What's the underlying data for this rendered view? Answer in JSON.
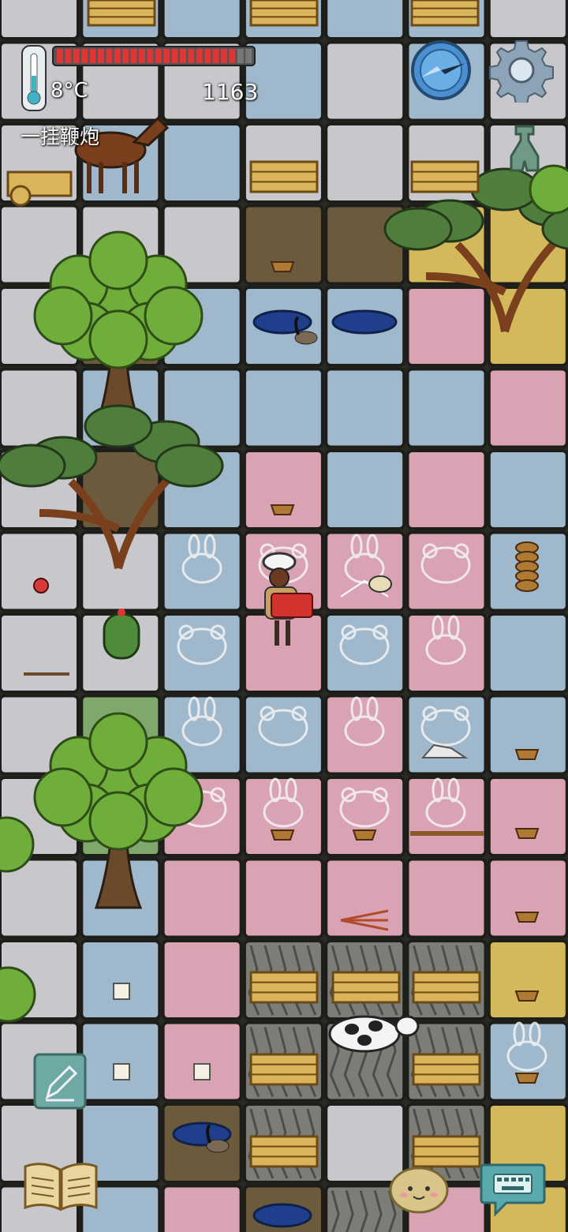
{
  "hud": {
    "temperature": "8°C",
    "health_level": 0.93,
    "score": "1163",
    "item_name": "一挂鞭炮"
  },
  "colors": {
    "blue": "#9fb8cc",
    "grey": "#c8c8cc",
    "pink": "#d9a3b4",
    "yellow": "#d4b85c",
    "green": "#7fa86a",
    "mud": "#6b5a3c",
    "stone": "#7d7d78",
    "health": "#e03535"
  },
  "icons": {
    "thermometer": "thermometer-icon",
    "compass": "compass-icon",
    "settings": "gear-icon",
    "coin": "ancient-coin-icon",
    "journal": "open-book-icon",
    "edit": "pencil-icon",
    "emote": "potato-face-icon",
    "keyboard": "keyboard-chat-icon"
  }
}
